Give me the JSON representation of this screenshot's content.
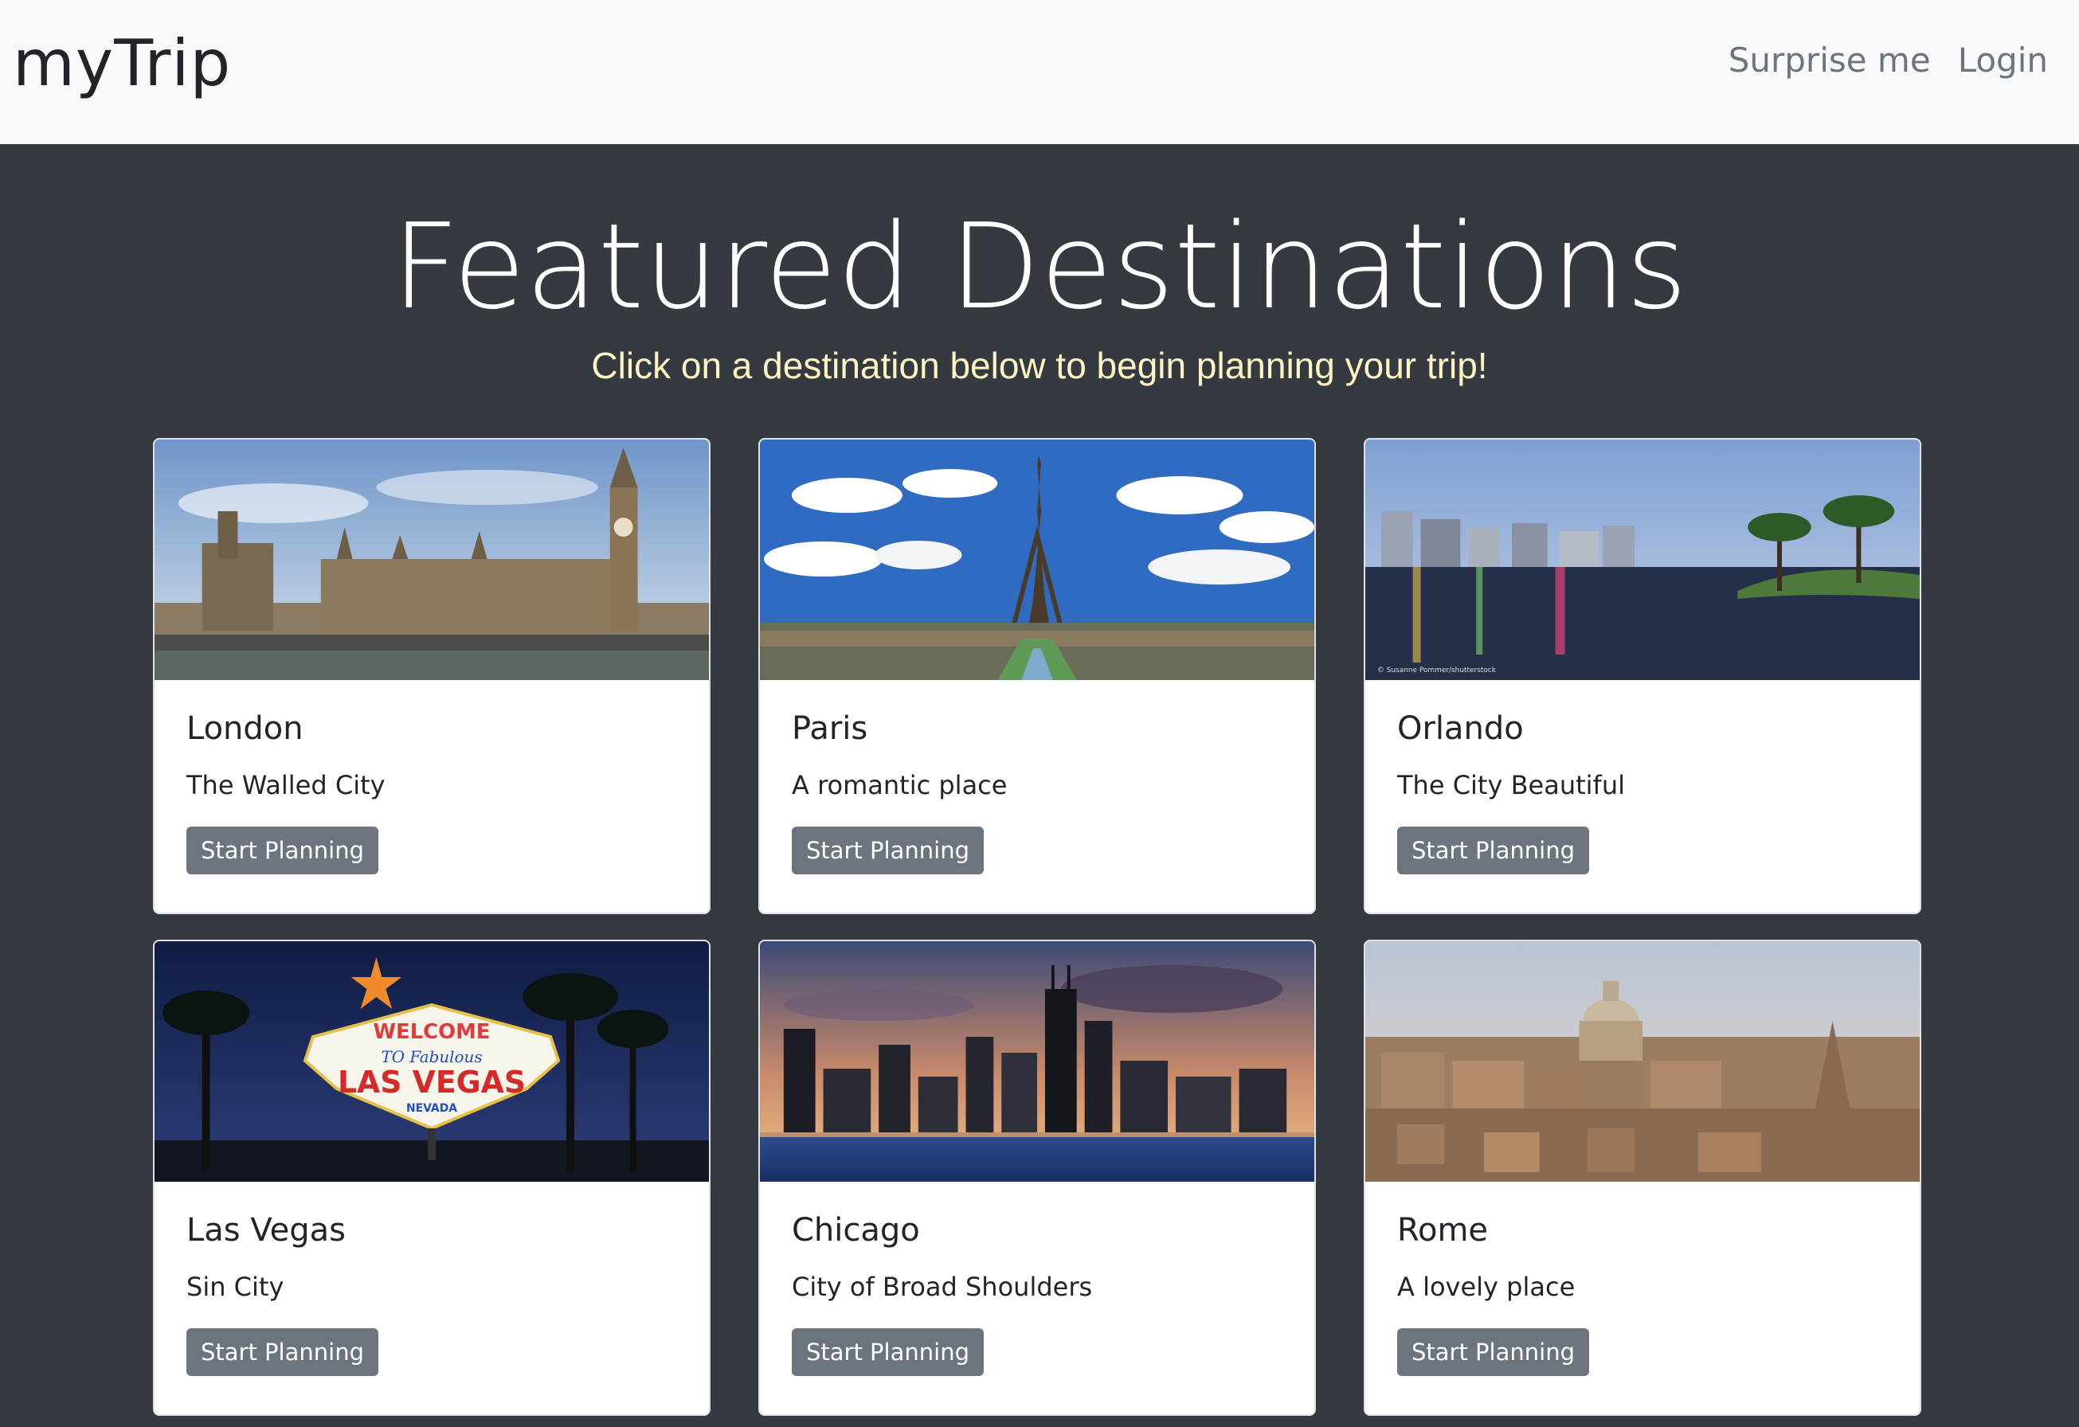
{
  "nav": {
    "brand": "myTrip",
    "links": [
      "Surprise me",
      "Login"
    ]
  },
  "hero": {
    "title": "Featured Destinations",
    "subtitle": "Click on a destination below to begin planning your trip!"
  },
  "destinations": [
    {
      "name": "London",
      "tagline": "The Walled City",
      "button": "Start Planning",
      "image": "london-skyline-photo"
    },
    {
      "name": "Paris",
      "tagline": "A romantic place",
      "button": "Start Planning",
      "image": "paris-eiffel-tower-photo"
    },
    {
      "name": "Orlando",
      "tagline": "The City Beautiful",
      "button": "Start Planning",
      "image": "orlando-lake-photo",
      "image_credit": "© Susanne Pommer/shutterstock"
    },
    {
      "name": "Las Vegas",
      "tagline": "Sin City",
      "button": "Start Planning",
      "image": "las-vegas-sign-photo",
      "sign": {
        "line1": "WELCOME",
        "line2": "TO Fabulous",
        "line3": "LAS VEGAS",
        "line4": "NEVADA"
      }
    },
    {
      "name": "Chicago",
      "tagline": "City of Broad Shoulders",
      "button": "Start Planning",
      "image": "chicago-skyline-photo"
    },
    {
      "name": "Rome",
      "tagline": "A lovely place",
      "button": "Start Planning",
      "image": "rome-cityscape-photo"
    }
  ]
}
